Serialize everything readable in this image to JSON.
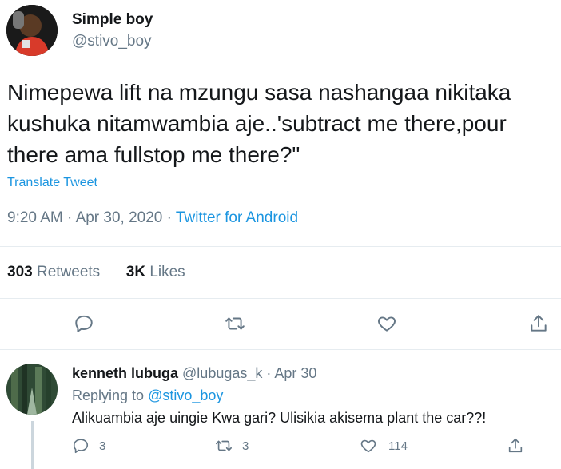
{
  "tweet": {
    "author_name": "Simple boy",
    "author_handle": "@stivo_boy",
    "text": "Nimepewa lift na mzungu sasa nashangaa nikitaka kushuka nitamwambia aje..'subtract me there,pour there ama fullstop me there?\"",
    "translate_label": "Translate Tweet",
    "time": "9:20 AM",
    "date": "Apr 30, 2020",
    "source": "Twitter for Android",
    "retweets_count": "303",
    "retweets_label": "Retweets",
    "likes_count": "3K",
    "likes_label": "Likes",
    "actions": {
      "reply_icon": "speech-bubble-icon",
      "retweet_icon": "retweet-arrows-icon",
      "like_icon": "heart-icon",
      "share_icon": "share-upload-icon"
    }
  },
  "reply": {
    "author_name": "kenneth lubuga",
    "author_handle": "@lubugas_k",
    "date": "Apr 30",
    "replying_prefix": "Replying to",
    "replying_to": "@stivo_boy",
    "text": "Alikuambia aje uingie Kwa gari? Ulisikia akisema plant the car??!",
    "reply_count": "3",
    "retweet_count": "3",
    "like_count": "114"
  },
  "colors": {
    "accent": "#1b95e0",
    "muted": "#657786",
    "text": "#14171a",
    "divider": "#e6ecf0"
  }
}
